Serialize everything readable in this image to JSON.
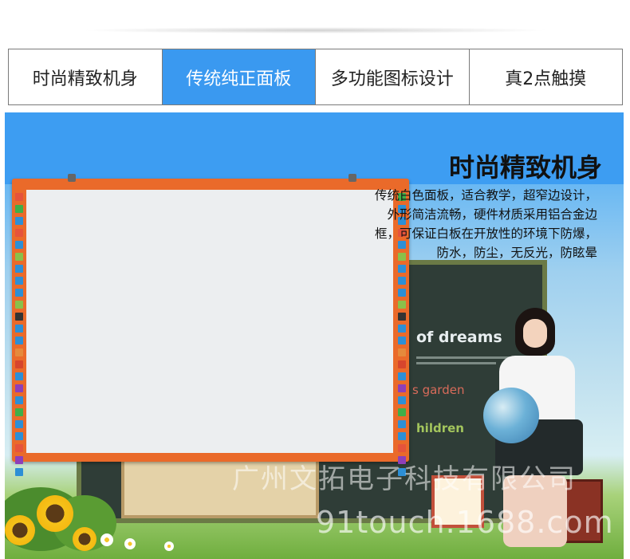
{
  "tabs": [
    {
      "label": "时尚精致机身",
      "active": false
    },
    {
      "label": "传统纯正面板",
      "active": true
    },
    {
      "label": "多功能图标设计",
      "active": false
    },
    {
      "label": "真2点触摸",
      "active": false
    }
  ],
  "hero": {
    "title": "时尚精致机身",
    "description": "传统白色面板，适合教学，超窄边设计，外形简洁流畅，硬件材质采用铝合金边框，可保证白板在开放性的环境下防爆，防水，防尘，无反光，防眩晕"
  },
  "chalkboard": {
    "line1": "of dreams",
    "line2": "s garden",
    "line3": "hildren"
  },
  "watermarks": {
    "company": "广州文拓电子科技有限公司",
    "site": "91touch.1688.com"
  },
  "colors": {
    "active_tab": "#3a99f0",
    "board_frame": "#ea6a2a",
    "hero_blue": "#3d9df2"
  }
}
